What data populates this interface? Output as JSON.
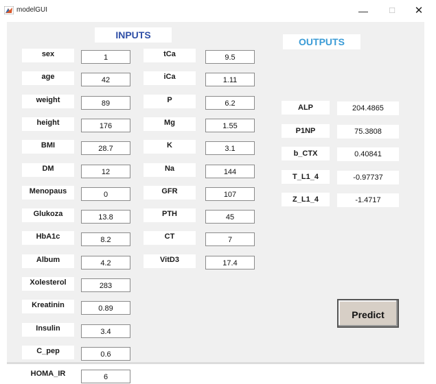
{
  "window": {
    "title": "modelGUI",
    "min_glyph": "—",
    "max_glyph": "☐",
    "close_glyph": "✕"
  },
  "inputs_header": "INPUTS",
  "outputs_header": "OUTPUTS",
  "inputs_col1": [
    {
      "label": "sex",
      "value": "1"
    },
    {
      "label": "age",
      "value": "42"
    },
    {
      "label": "weight",
      "value": "89"
    },
    {
      "label": "height",
      "value": "176"
    },
    {
      "label": "BMI",
      "value": "28.7"
    },
    {
      "label": "DM",
      "value": "12"
    },
    {
      "label": "Menopaus",
      "value": "0"
    },
    {
      "label": "Glukoza",
      "value": "13.8"
    },
    {
      "label": "HbA1c",
      "value": "8.2"
    },
    {
      "label": "Album",
      "value": "4.2"
    },
    {
      "label": "Xolesterol",
      "value": "283"
    },
    {
      "label": "Kreatinin",
      "value": "0.89"
    },
    {
      "label": "Insulin",
      "value": "3.4"
    },
    {
      "label": "C_pep",
      "value": "0.6"
    },
    {
      "label": "HOMA_IR",
      "value": "6"
    }
  ],
  "inputs_col2": [
    {
      "label": "tCa",
      "value": "9.5"
    },
    {
      "label": "iCa",
      "value": "1.11"
    },
    {
      "label": "P",
      "value": "6.2"
    },
    {
      "label": "Mg",
      "value": "1.55"
    },
    {
      "label": "K",
      "value": "3.1"
    },
    {
      "label": "Na",
      "value": "144"
    },
    {
      "label": "GFR",
      "value": "107"
    },
    {
      "label": "PTH",
      "value": "45"
    },
    {
      "label": "CT",
      "value": "7"
    },
    {
      "label": "VitD3",
      "value": "17.4"
    }
  ],
  "outputs": [
    {
      "label": "ALP",
      "value": "204.4865"
    },
    {
      "label": "P1NP",
      "value": "75.3808"
    },
    {
      "label": "b_CTX",
      "value": "0.40841"
    },
    {
      "label": "T_L1_4",
      "value": "-0.97737"
    },
    {
      "label": "Z_L1_4",
      "value": "-1.4717"
    }
  ],
  "predict_label": "Predict"
}
